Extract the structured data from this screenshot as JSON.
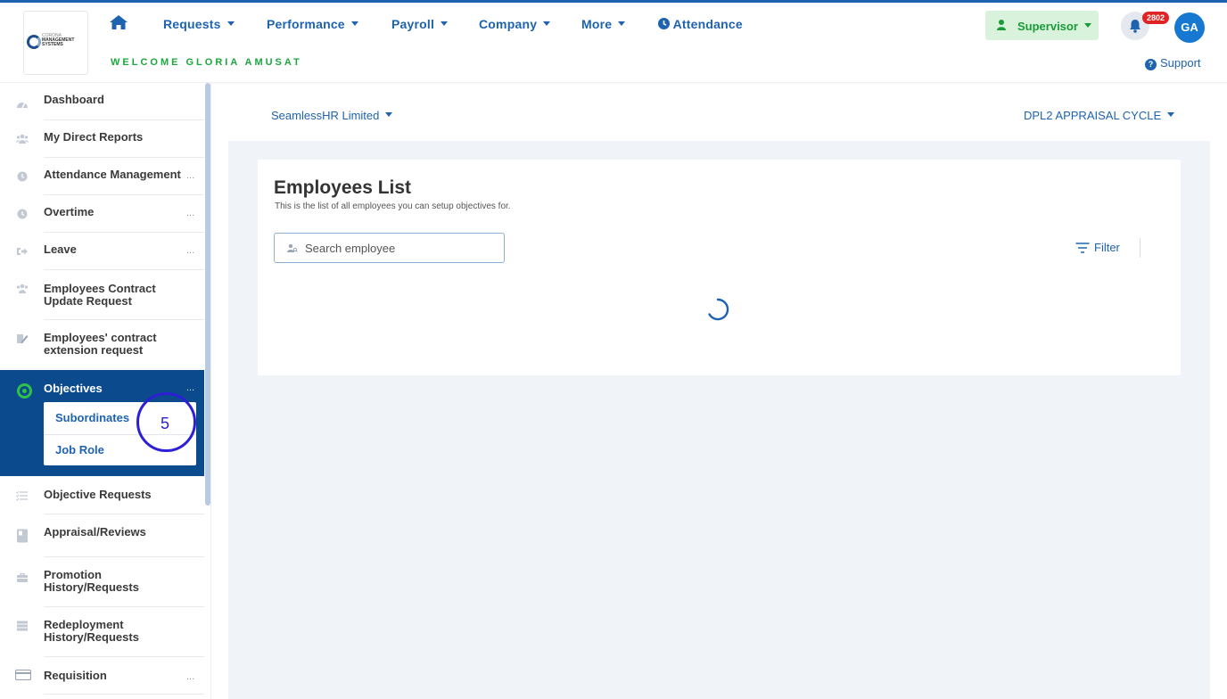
{
  "header": {
    "logo_text_line1": "CORONA",
    "logo_text_line2": "MANAGEMENT",
    "logo_text_line3": "SYSTEMS",
    "nav": [
      {
        "label": "Requests"
      },
      {
        "label": "Performance"
      },
      {
        "label": "Payroll"
      },
      {
        "label": "Company"
      },
      {
        "label": "More"
      }
    ],
    "attendance_label": "Attendance",
    "welcome": "WELCOME GLORIA AMUSAT",
    "role_label": "Supervisor",
    "notification_count": "2802",
    "avatar_initials": "GA",
    "support_label": "Support",
    "accent_color": "#1e63b0"
  },
  "sidebar": {
    "items": [
      {
        "label": "Dashboard",
        "icon": "dashboard-icon"
      },
      {
        "label": "My Direct Reports",
        "icon": "users-icon"
      },
      {
        "label": "Attendance Management",
        "icon": "clock-icon",
        "dots": "..."
      },
      {
        "label": "Overtime",
        "icon": "clock-icon",
        "dots": "..."
      },
      {
        "label": "Leave",
        "icon": "sign-out-icon",
        "dots": "..."
      },
      {
        "label_line1": "Employees Contract",
        "label_line2": "Update Request",
        "icon": "users-icon"
      },
      {
        "label_line1": "Employees' contract",
        "label_line2": "extension request",
        "icon": "edit-icon"
      },
      {
        "label": "Objectives",
        "icon": "target-icon",
        "dots": "...",
        "active": true
      },
      {
        "label": "Objective Requests",
        "icon": "list-icon"
      },
      {
        "label": "Appraisal/Reviews",
        "icon": "book-icon"
      },
      {
        "label_line1": "Promotion",
        "label_line2": "History/Requests",
        "icon": "briefcase-icon"
      },
      {
        "label_line1": "Redeployment",
        "label_line2": "History/Requests",
        "icon": "server-icon"
      },
      {
        "label": "Requisition",
        "icon": "credit-card-icon",
        "dots": "..."
      }
    ],
    "objectives_submenu": [
      {
        "label": "Subordinates"
      },
      {
        "label": "Job Role"
      }
    ],
    "annotation_number": "5"
  },
  "main": {
    "company_label": "SeamlessHR Limited",
    "cycle_label": "DPL2 APPRAISAL CYCLE",
    "card_title": "Employees List",
    "card_subtitle": "This is the list of all employees you can setup objectives for.",
    "search_placeholder": "Search employee",
    "filter_label": "Filter",
    "loading": true
  }
}
